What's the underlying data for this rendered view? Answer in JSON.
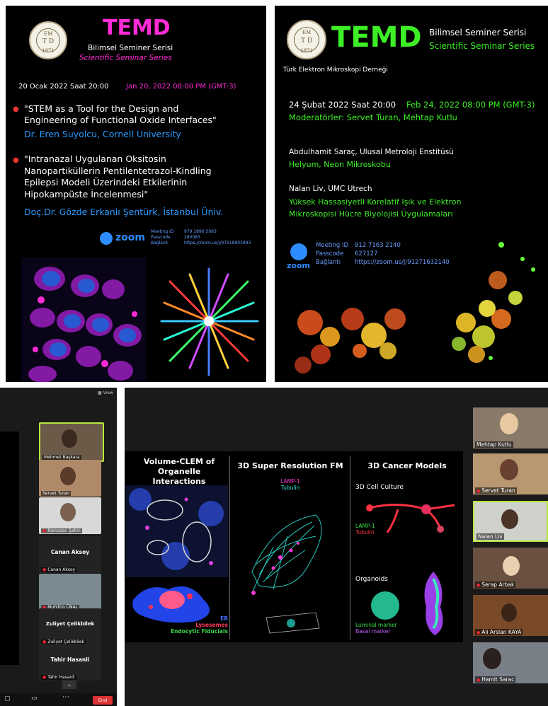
{
  "poster1": {
    "brand": "TEMD",
    "series_tr": "Bilimsel Seminer Serisi",
    "series_en": "Scientific Seminar Series",
    "logo_top": "EM",
    "logo_mid": "T  D",
    "logo_year": "1971",
    "date_tr": "20 Ocak 2022 Saat 20:00",
    "date_en": "Jan 20, 2022 08:00 PM (GMT-3)",
    "talks": [
      {
        "title_lines": [
          "\"STEM as a Tool for the Design and",
          "Engineering of Functional Oxide Interfaces\""
        ],
        "speaker": "Dr. Eren Suyolcu, Cornell University"
      },
      {
        "title_lines": [
          "\"Intranazal Uygulanan Oksitosin",
          "Nanopartiküllerin Pentilentetrazol-Kindling",
          "Epilepsi Modeli Üzerindeki Etkilerinin",
          "Hipokampüste İncelenmesi\""
        ],
        "speaker": "Doç.Dr. Gözde Erkanlı Şentürk, İstanbul Üniv."
      }
    ],
    "zoom_label": "zoom",
    "meeting_labels": [
      "Meeting ID",
      "Passcode",
      "Bağlantı"
    ],
    "meeting_values": [
      "979 1890 5993",
      "280083",
      "https://zoom.us/j/97918905993"
    ]
  },
  "poster2": {
    "brand": "TEMD",
    "series_tr": "Bilimsel Seminer Serisi",
    "series_en": "Scientific Seminar Series",
    "society": "Türk Elektron Mikroskopi Derneği",
    "logo_top": "EM",
    "logo_mid": "T  D",
    "logo_year": "1971",
    "date_tr": "24 Şubat 2022 Saat 20:00",
    "date_en": "Feb 24, 2022 08:00 PM (GMT-3)",
    "moderators": "Moderatörler: Servet Turan, Mehtap Kutlu",
    "speaker1": "Abdulhamit Saraç, Ulusal Metroloji Enstitüsü",
    "talk1": "Helyum, Neon Mikroskobu",
    "speaker2": "Nalan Liv, UMC Utrech",
    "talk2_lines": [
      "Yüksek Hassasiyetli Korelatif Işık ve Elektron",
      "Mikroskopisi Hücre Biyolojisi Uygulamaları"
    ],
    "zoom_label": "zoom",
    "meeting_labels": [
      "Meeting ID",
      "Passcode",
      "Bağlantı"
    ],
    "meeting_values": [
      "912 7163 2140",
      "627127",
      "https://zoom.us/j/91271632140"
    ]
  },
  "zoom1": {
    "view_label": "View",
    "participants": [
      "Mehmet Başkara",
      "Servet Turan",
      "Ramazan Şahin"
    ],
    "name_tiles": [
      {
        "big": "Canan Aksoy",
        "small": "Canan Aksoy"
      },
      {
        "big": "",
        "small": "Muhittin ÜNAL"
      },
      {
        "big": "Zuliyet Çelikbilek",
        "small": "Zuliyet Çelikbilek"
      },
      {
        "big": "Tahir Hasanli",
        "small": "Tahir Hasanli"
      }
    ],
    "end_label": "End"
  },
  "zoom2": {
    "slide": {
      "col1_title_lines": [
        "Volume-CLEM of",
        "Organelle Interactions"
      ],
      "col1_legend": [
        "ER",
        "Lysosomes",
        "Endocytic Fiducials"
      ],
      "col2_title": "3D Super Resolution FM",
      "col2_legend": [
        "LAMP-1",
        "Tubulin"
      ],
      "col3_title": "3D Cancer Models",
      "col3_sub1": "3D Cell Culture",
      "col3_legend": [
        "LAMP-1",
        "Tubulin"
      ],
      "col3_sub2": "Organoids",
      "col3_markers": [
        "Luminal marker",
        "Basal marker"
      ]
    },
    "participants": [
      "Mehtap Kutlu",
      "Servet Turan",
      "Nalan Liv",
      "Serap Arbak",
      "Ali Arslan KAYA",
      "Hamit Sarac"
    ]
  },
  "colors": {
    "magenta": "#ff2bd6",
    "green": "#3df026",
    "blue_link": "#2a9bff",
    "red_bullet": "#e33333",
    "active_border": "#b7e83a"
  }
}
